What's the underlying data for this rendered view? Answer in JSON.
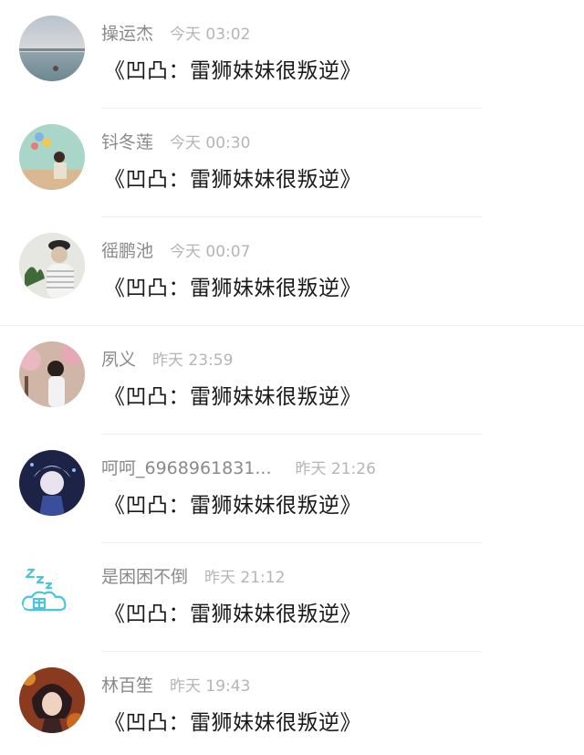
{
  "comments": [
    {
      "name": "操运杰",
      "time": "今天 03:02",
      "title": "《凹凸：雷狮妹妹很叛逆》",
      "avatar_icon": "lake-photo-avatar"
    },
    {
      "name": "钭冬莲",
      "time": "今天 00:30",
      "title": "《凹凸：雷狮妹妹很叛逆》",
      "avatar_icon": "balloon-girl-avatar"
    },
    {
      "name": "徭鹏池",
      "time": "今天 00:07",
      "title": "《凹凸：雷狮妹妹很叛逆》",
      "avatar_icon": "hat-girl-avatar"
    },
    {
      "name": "夙义",
      "time": "昨天 23:59",
      "title": "《凹凸：雷狮妹妹很叛逆》",
      "avatar_icon": "flower-girl-avatar"
    },
    {
      "name": "呵呵_6968961831...",
      "time": "昨天 21:26",
      "title": "《凹凸：雷狮妹妹很叛逆》",
      "avatar_icon": "anime-boy-avatar"
    },
    {
      "name": "是困困不倒",
      "time": "昨天 21:12",
      "title": "《凹凸：雷狮妹妹很叛逆》",
      "avatar_icon": "sleepy-cloud-avatar"
    },
    {
      "name": "林百笙",
      "time": "昨天 19:43",
      "title": "《凹凸：雷狮妹妹很叛逆》",
      "avatar_icon": "anime-character-avatar"
    }
  ]
}
